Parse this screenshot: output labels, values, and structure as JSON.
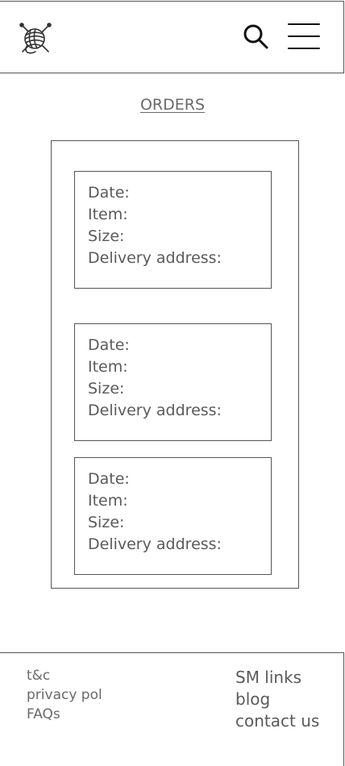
{
  "header": {
    "logo_icon": "yarn-ball-knitting-needles-icon",
    "search_icon": "search-icon",
    "menu_icon": "hamburger-menu-icon"
  },
  "main": {
    "title": "ORDERS",
    "orders": [
      {
        "date_label": "Date:",
        "item_label": "Item:",
        "size_label": "Size:",
        "address_label": "Delivery address:"
      },
      {
        "date_label": "Date:",
        "item_label": "Item:",
        "size_label": "Size:",
        "address_label": "Delivery address:"
      },
      {
        "date_label": "Date:",
        "item_label": "Item:",
        "size_label": "Size:",
        "address_label": "Delivery address:"
      }
    ]
  },
  "footer": {
    "left_links": [
      "t&c",
      "privacy pol",
      "FAQs"
    ],
    "right_links": [
      "SM links",
      "blog",
      "contact us"
    ]
  },
  "colors": {
    "line": "#555555",
    "text": "#5a5a5a",
    "background": "#ffffff"
  }
}
